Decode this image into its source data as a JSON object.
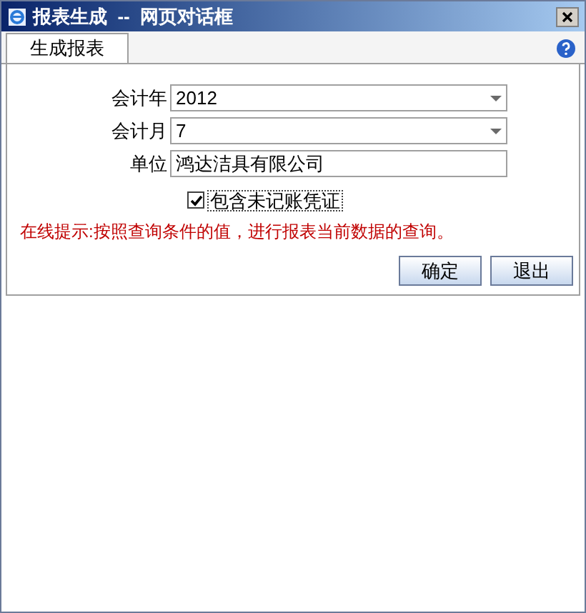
{
  "window": {
    "title": "报表生成  --  网页对话框"
  },
  "tabs": [
    {
      "label": "生成报表",
      "selected": true
    }
  ],
  "form": {
    "fields": [
      {
        "kind": "select",
        "label": "会计年",
        "value": "2012"
      },
      {
        "kind": "select",
        "label": "会计月",
        "value": "7"
      },
      {
        "kind": "text",
        "label": "单位",
        "value": "鸿达洁具有限公司"
      }
    ],
    "checkbox": {
      "label": "包含未记账凭证",
      "checked": true
    }
  },
  "hint": "在线提示:按照查询条件的值，进行报表当前数据的查询。",
  "buttons": [
    "确定",
    "退出"
  ]
}
